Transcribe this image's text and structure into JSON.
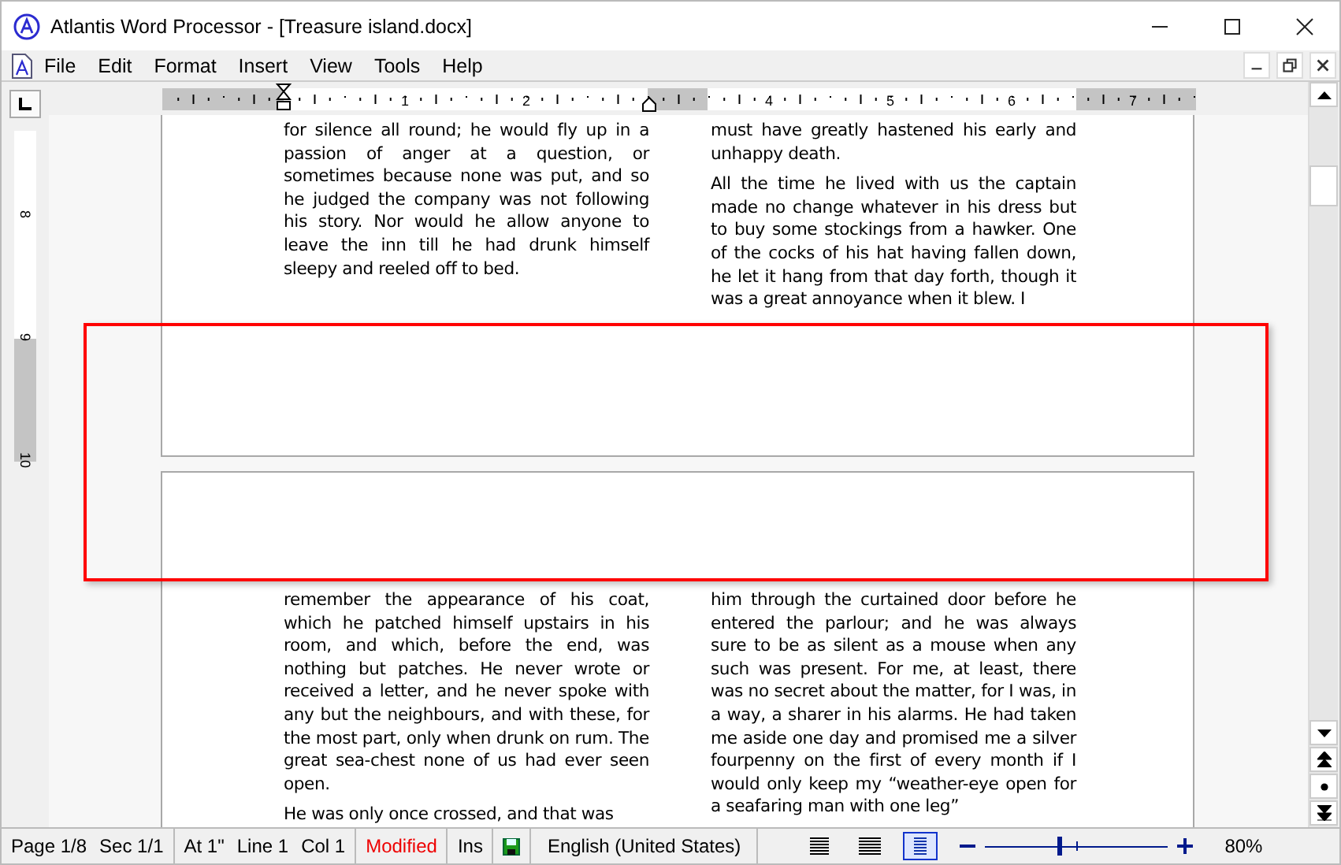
{
  "window": {
    "title": "Atlantis Word Processor - [Treasure island.docx]"
  },
  "menu": [
    "File",
    "Edit",
    "Format",
    "Insert",
    "View",
    "Tools",
    "Help"
  ],
  "ruler": {
    "labels": [
      "1",
      "2",
      "4",
      "5",
      "6",
      "7"
    ]
  },
  "vertical_ruler": {
    "labels": [
      "8",
      "9",
      "10"
    ]
  },
  "pages": [
    {
      "columns": [
        [
          "for silence all round; he would fly up in a passion of anger at a question, or sometimes because none was put, and so he judged the company was not following his story. Nor would he allow anyone to leave the inn till he had drunk himself sleepy and reeled off to bed."
        ],
        [
          "must have greatly hastened his early and unhappy death.",
          "All the time he lived with us the captain made no change whatever in his dress but to buy some stockings from a hawker. One of the cocks of his hat having fallen down, he let it hang from that day forth, though it was a great annoyance when it blew. I"
        ]
      ]
    },
    {
      "columns": [
        [
          "remember the appearance of his coat, which he patched himself upstairs in his room, and which, before the end, was nothing but patches. He never wrote or received a letter, and he never spoke with any but the neighbours, and with these, for the most part, only when drunk on rum. The great sea-chest none of us had ever seen open.",
          "He was only once crossed, and that was"
        ],
        [
          "him through the curtained door before he entered the parlour; and he was always sure to be as silent as a mouse when any such was present. For me, at least, there was no secret about the matter, for I was, in a way, a sharer in his alarms. He had taken me aside one day and promised me a silver fourpenny on the first of every month if I would only keep my “weather-eye open for a seafaring man with one leg”"
        ]
      ]
    }
  ],
  "status_bar": {
    "page": "Page 1/8",
    "section": "Sec 1/1",
    "position": [
      "At 1\"",
      "Line 1",
      "Col 1"
    ],
    "modified": "Modified",
    "mode": "Ins",
    "language": "English (United States)",
    "views": [
      {
        "selected": false
      },
      {
        "selected": false
      },
      {
        "selected": true
      }
    ],
    "zoom": {
      "level": 0.4,
      "reading": "80%"
    }
  }
}
